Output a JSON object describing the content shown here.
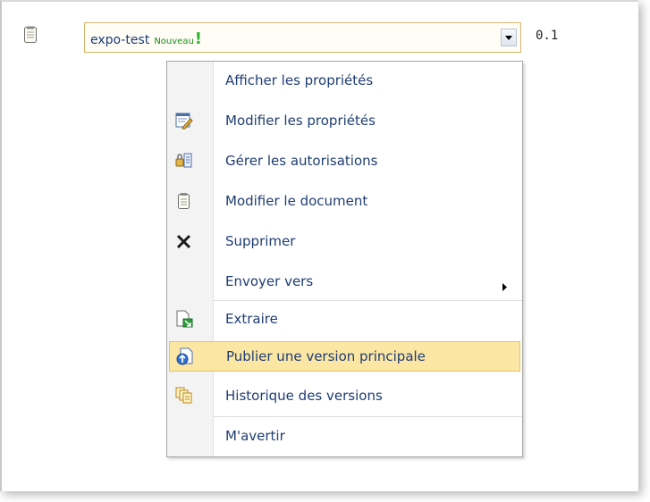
{
  "item": {
    "title": "expo-test",
    "new_badge": "Nouveau",
    "new_mark": "!",
    "version": "0.1"
  },
  "menu": {
    "items": [
      {
        "label": "Afficher les propriétés",
        "icon": "none"
      },
      {
        "label": "Modifier les propriétés",
        "icon": "edit-properties-icon"
      },
      {
        "label": "Gérer les autorisations",
        "icon": "permissions-icon"
      },
      {
        "label": "Modifier le document",
        "icon": "document-icon"
      },
      {
        "label": "Supprimer",
        "icon": "delete-x-icon"
      },
      {
        "label": "Envoyer vers",
        "icon": "none",
        "submenu": true
      },
      {
        "label": "Extraire",
        "icon": "check-out-icon"
      },
      {
        "label": "Publier une version principale",
        "icon": "publish-icon",
        "highlighted": true
      },
      {
        "label": "Historique des versions",
        "icon": "version-history-icon"
      },
      {
        "label": "M'avertir",
        "icon": "none"
      }
    ]
  },
  "colors": {
    "menu_text": "#1f3d73",
    "highlight_bg": "#fce6a4",
    "highlight_border": "#e5c365",
    "new_badge": "#1a8a1a"
  }
}
